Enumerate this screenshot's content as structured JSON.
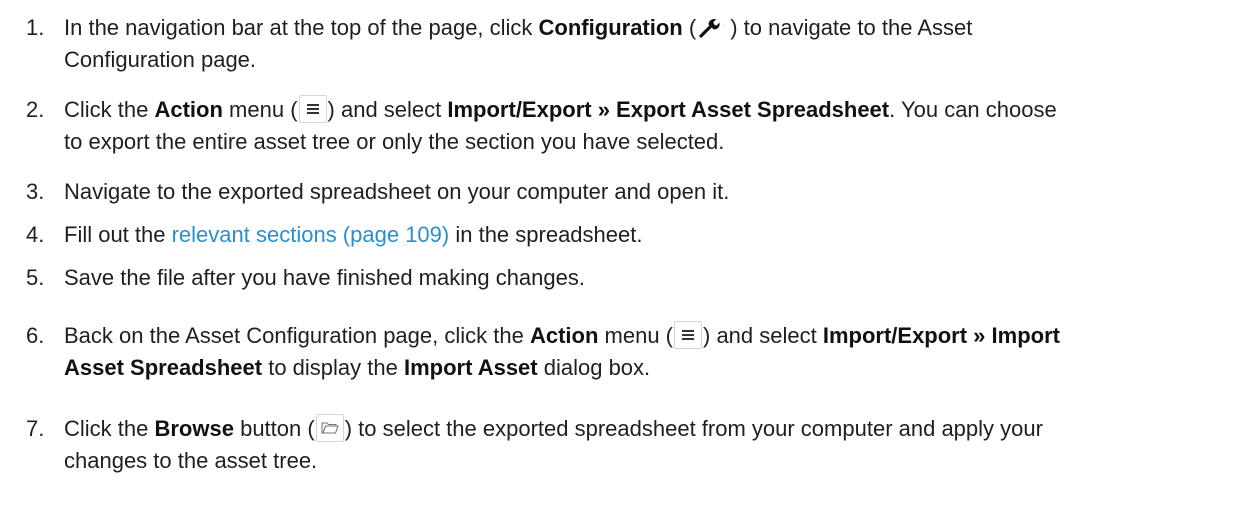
{
  "icons": {
    "configuration": "wrench-icon",
    "action": "hamburger-menu-icon",
    "browse": "folder-open-icon"
  },
  "steps": [
    {
      "number": "1.",
      "text_a": "In the navigation bar at the top of the page, click ",
      "bold_a": "Configuration",
      "text_b": " (",
      "text_c": ") to navigate to the Asset",
      "text_d": "Configuration page."
    },
    {
      "number": "2.",
      "text_a": "Click the ",
      "bold_a": "Action",
      "text_b": " menu (",
      "text_c": ") and select ",
      "bold_b": "Import/Export » Export Asset Spreadsheet",
      "text_d": ". You can choose",
      "text_e": "to export the entire asset tree or only the section you have selected."
    },
    {
      "number": "3.",
      "text_a": "Navigate to the exported spreadsheet on your computer and open it."
    },
    {
      "number": "4.",
      "text_a": "Fill out the ",
      "link": "relevant sections (page 109)",
      "text_b": " in the spreadsheet."
    },
    {
      "number": "5.",
      "text_a": "Save the file after you have finished making changes."
    },
    {
      "number": "6.",
      "text_a": "Back on the Asset Configuration page, click the ",
      "bold_a": "Action",
      "text_b": " menu (",
      "text_c": ") and select ",
      "bold_b": "Import/Export » Import",
      "bold_c": "Asset Spreadsheet",
      "text_d": " to display the ",
      "bold_d": "Import Asset",
      "text_e": " dialog box."
    },
    {
      "number": "7.",
      "text_a": "Click the ",
      "bold_a": "Browse",
      "text_b": " button (",
      "text_c": ") to select the exported spreadsheet from your computer and apply your",
      "text_d": "changes to the asset tree."
    }
  ]
}
